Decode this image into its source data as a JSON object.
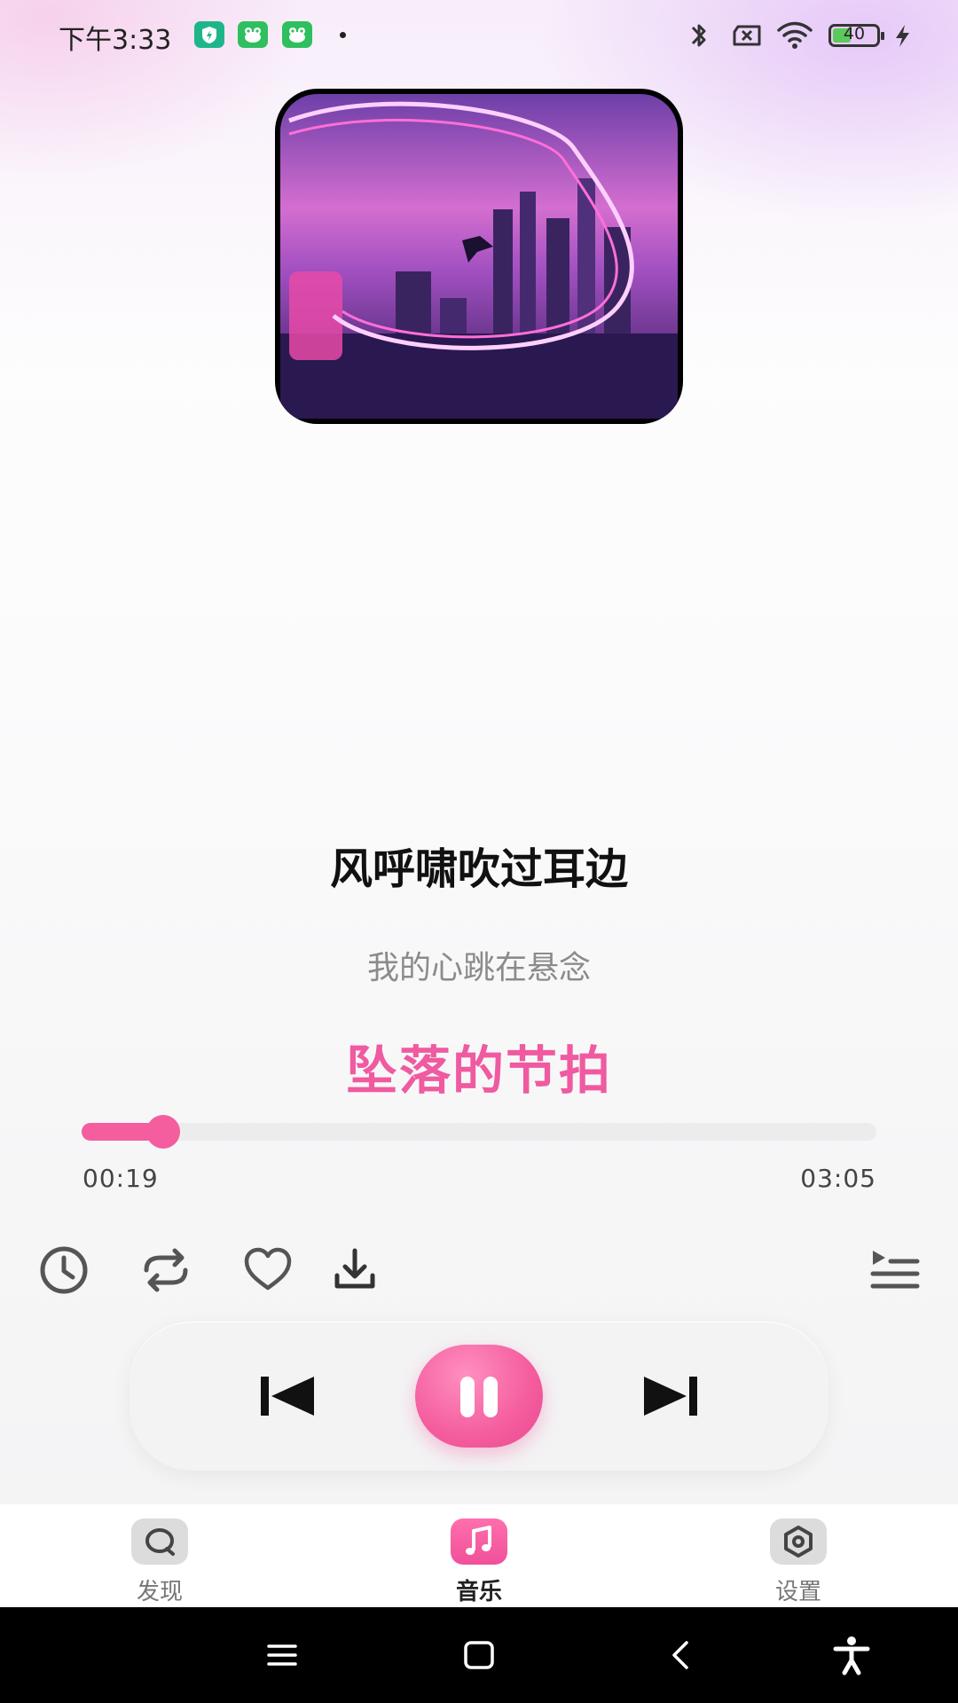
{
  "status_bar": {
    "time": "下午3:33",
    "battery_level": "40",
    "icons": [
      "shield-app-icon",
      "frog-app-icon",
      "frog-app-icon",
      "dot-icon",
      "bluetooth-icon",
      "sim-x-icon",
      "wifi-icon",
      "battery-icon",
      "charging-icon"
    ]
  },
  "album": {
    "icon": "album-cover-image"
  },
  "lyrics": {
    "previous": "风呼啸吹过耳边",
    "current": "我的心跳在悬念",
    "next": "坠落的节拍"
  },
  "player": {
    "elapsed": "00:19",
    "total": "03:05",
    "progress_fraction": 0.103,
    "accent_color": "#f45d9e"
  },
  "actions": [
    "timer-icon",
    "repeat-icon",
    "heart-icon",
    "download-icon",
    "playlist-icon"
  ],
  "controls": [
    "previous-icon",
    "pause-icon",
    "next-icon"
  ],
  "tabs": [
    {
      "label": "发现",
      "icon": "discover-icon",
      "active": false
    },
    {
      "label": "音乐",
      "icon": "music-icon",
      "active": true
    },
    {
      "label": "设置",
      "icon": "settings-icon",
      "active": false
    }
  ],
  "nav": [
    "menu-icon",
    "home-icon",
    "back-icon",
    "accessibility-icon"
  ]
}
